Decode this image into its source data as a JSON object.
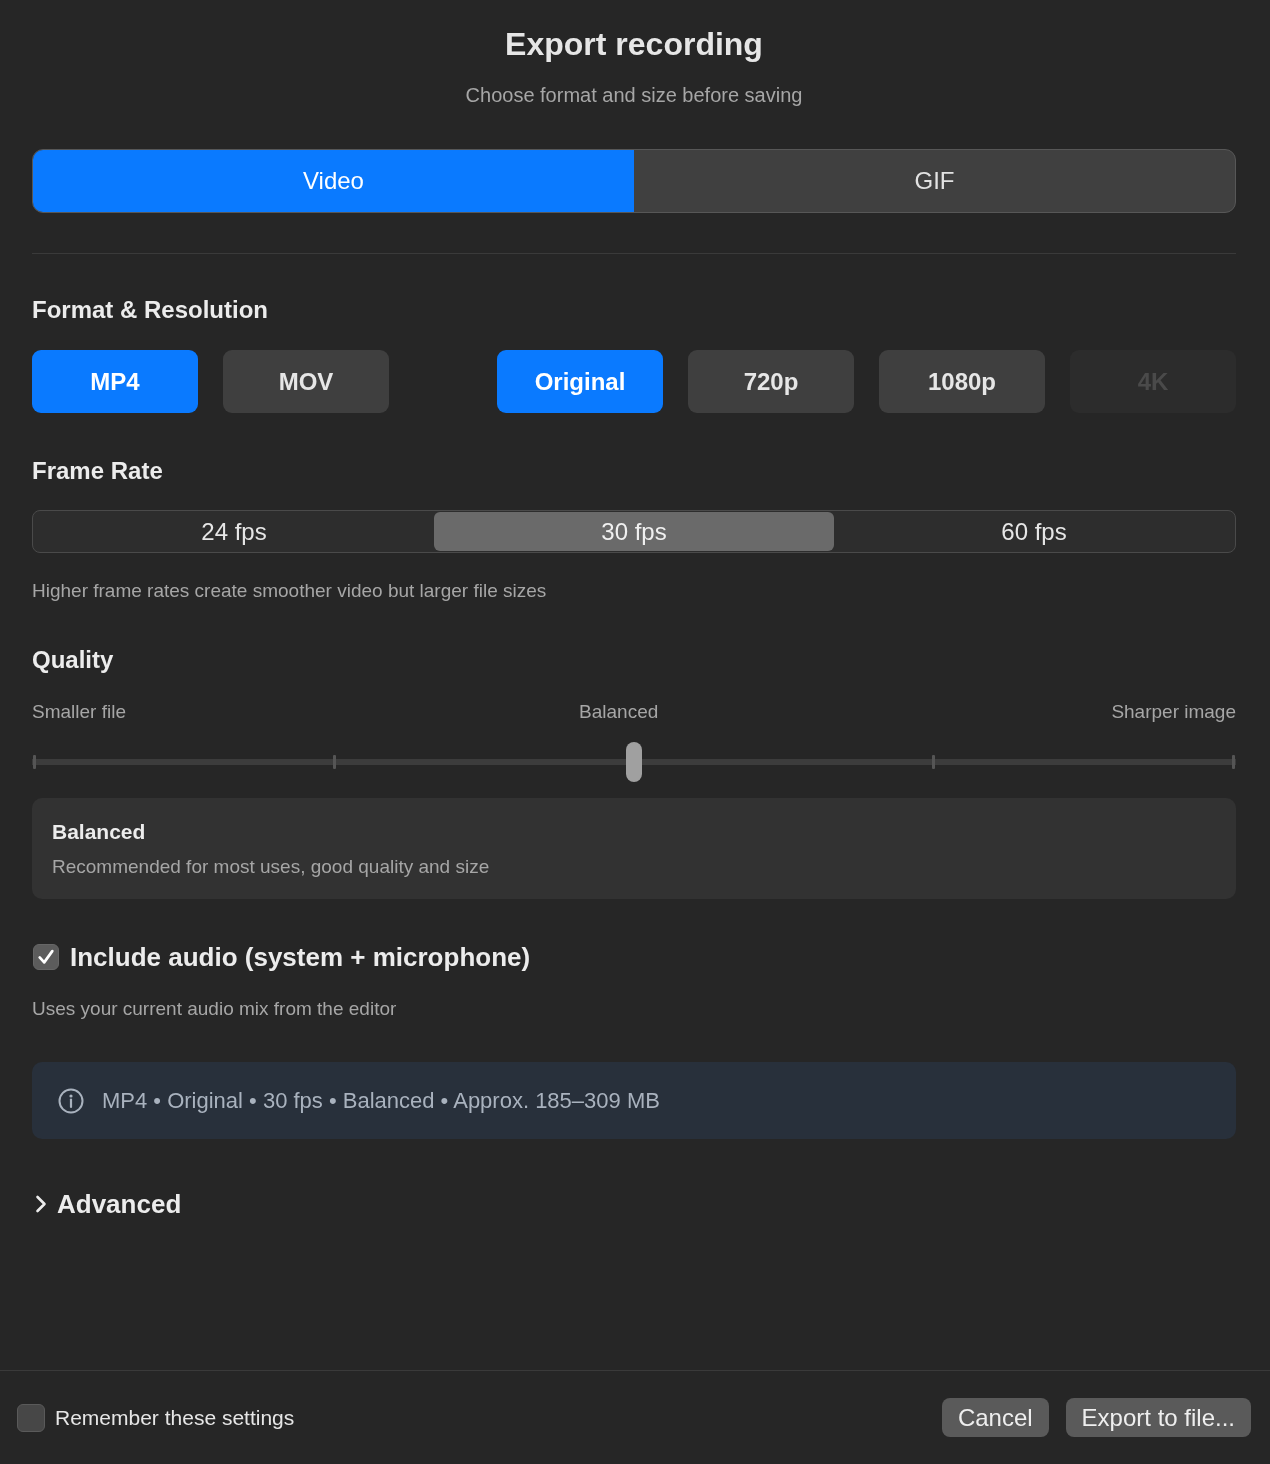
{
  "dialog": {
    "title": "Export recording",
    "subtitle": "Choose format and size before saving"
  },
  "tabs": [
    {
      "label": "Video",
      "selected": true
    },
    {
      "label": "GIF",
      "selected": false
    }
  ],
  "format_resolution": {
    "heading": "Format & Resolution",
    "formats": [
      {
        "label": "MP4",
        "selected": true,
        "disabled": false
      },
      {
        "label": "MOV",
        "selected": false,
        "disabled": false
      }
    ],
    "resolutions": [
      {
        "label": "Original",
        "selected": true,
        "disabled": false
      },
      {
        "label": "720p",
        "selected": false,
        "disabled": false
      },
      {
        "label": "1080p",
        "selected": false,
        "disabled": false
      },
      {
        "label": "4K",
        "selected": false,
        "disabled": true
      }
    ]
  },
  "frame_rate": {
    "heading": "Frame Rate",
    "options": [
      {
        "label": "24 fps",
        "selected": false
      },
      {
        "label": "30 fps",
        "selected": true
      },
      {
        "label": "60 fps",
        "selected": false
      }
    ],
    "hint": "Higher frame rates create smoother video but larger file sizes"
  },
  "quality": {
    "heading": "Quality",
    "scale_labels": [
      "Smaller file",
      "Balanced",
      "Sharper image"
    ],
    "slider": {
      "level": 0.5
    },
    "card": {
      "title": "Balanced",
      "description": "Recommended for most uses, good quality and size"
    }
  },
  "audio": {
    "label": "Include audio (system + microphone)",
    "checked": true,
    "hint": "Uses your current audio mix from the editor"
  },
  "summary": {
    "text": "MP4 • Original • 30 fps • Balanced • Approx. 185–309 MB"
  },
  "advanced": {
    "label": "Advanced",
    "expanded": false
  },
  "footer": {
    "remember": {
      "label": "Remember these settings",
      "checked": false
    },
    "buttons": [
      {
        "label": "Cancel"
      },
      {
        "label": "Export to file..."
      }
    ]
  }
}
